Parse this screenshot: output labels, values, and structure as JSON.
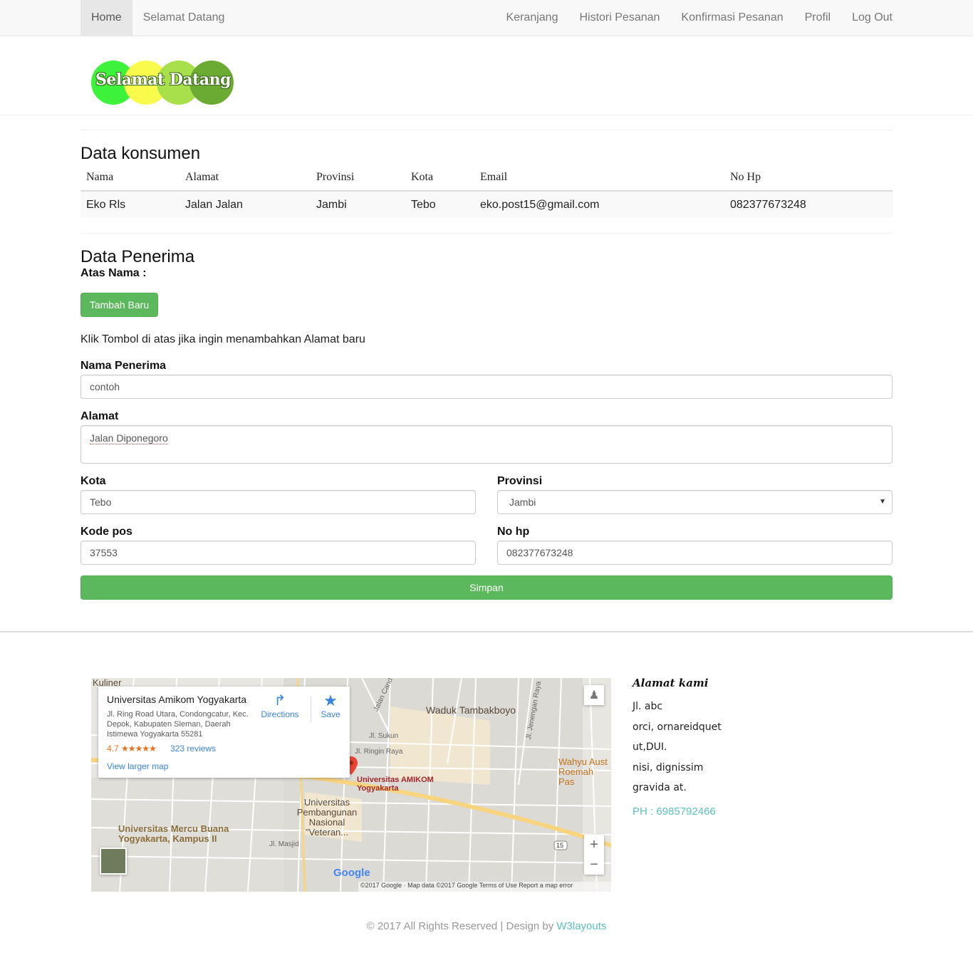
{
  "nav": {
    "left": [
      "Home",
      "Selamat Datang"
    ],
    "right": [
      "Keranjang",
      "Histori Pesanan",
      "Konfirmasi Pesanan",
      "Profil",
      "Log Out"
    ]
  },
  "logo": {
    "text": "Selamat Datang"
  },
  "konsumen": {
    "title": "Data konsumen",
    "headers": [
      "Nama",
      "Alamat",
      "Provinsi",
      "Kota",
      "Email",
      "No Hp"
    ],
    "row": [
      "Eko Rls",
      "Jalan Jalan",
      "Jambi",
      "Tebo",
      "eko.post15@gmail.com",
      "082377673248"
    ]
  },
  "penerima": {
    "title": "Data Penerima",
    "atas_nama": "Atas Nama :",
    "add_button": "Tambah Baru",
    "hint": "Klik Tombol di atas jika ingin menambahkan Alamat baru",
    "nama_label": "Nama Penerima",
    "nama_value": "contoh",
    "alamat_label": "Alamat",
    "alamat_value": "Jalan Diponegoro",
    "kota_label": "Kota",
    "kota_value": "Tebo",
    "provinsi_label": "Provinsi",
    "provinsi_value": "Jambi",
    "kodepos_label": "Kode pos",
    "kodepos_value": "37553",
    "nohp_label": "No hp",
    "nohp_value": "082377673248",
    "save_button": "Simpan"
  },
  "map": {
    "place_name": "Universitas Amikom Yogyakarta",
    "address": "Jl. Ring Road Utara, Condongcatur, Kec. Depok, Kabupaten Sleman, Daerah Istimewa Yogyakarta 55281",
    "rating": "4.7",
    "stars": "★★★★★",
    "reviews": "323 reviews",
    "larger_map": "View larger map",
    "directions": "Directions",
    "save": "Save",
    "labels": {
      "kuliner": "Kuliner",
      "waduk": "Waduk Tambakboyo",
      "amikom": "Universitas AMIKOM Yogyakarta",
      "upn": "Universitas Pembangunan Nasional \"Veteran...",
      "mercu": "Universitas Mercu Buana Yogyakarta, Kampus II",
      "wahyu": "Wahyu Aust Roemah Pas",
      "sukun": "Jl. Sukun",
      "ringin": "Jl. Ringin Raya",
      "masjid": "Jl. Masjid",
      "candi": "Jalan Cand",
      "jenengan": "Jl. Jenengan Raya",
      "route": "15"
    },
    "attribution": "©2017 Google · Map data ©2017 Google   Terms of Use   Report a map error",
    "google": "Google",
    "zoom_in": "+",
    "zoom_out": "−"
  },
  "address": {
    "title": "Alamat kami",
    "lines": [
      "Jl. abc",
      "orci, ornareidquet",
      "ut,DUI.",
      "nisi, dignissim",
      "gravida at."
    ],
    "phone": "PH : 6985792466"
  },
  "footer": {
    "copyright": "© 2017 All Rights Reserved | Design by ",
    "link": "W3layouts"
  },
  "colors": {
    "green": "#5cb85c",
    "teal": "#5bc0be"
  }
}
